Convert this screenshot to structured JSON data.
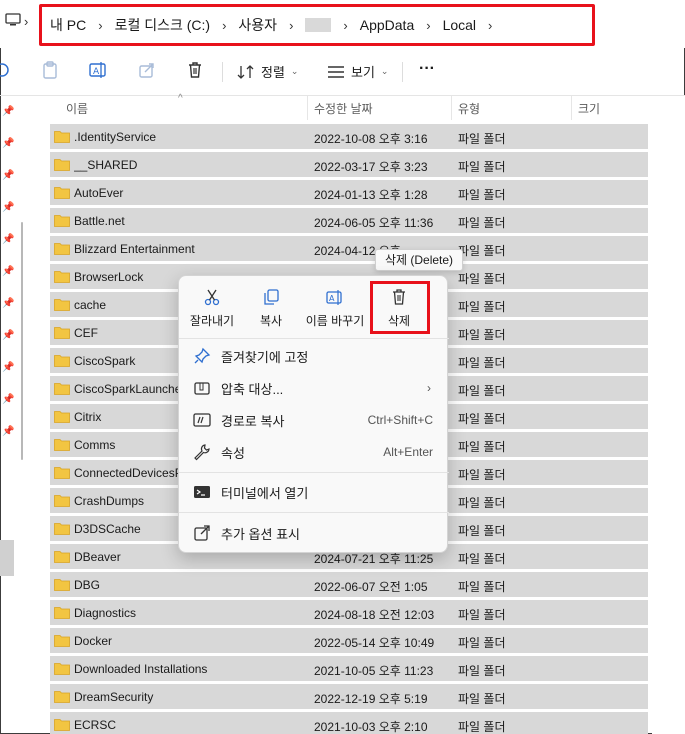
{
  "breadcrumbs": [
    "내 PC",
    "로컬 디스크 (C:)",
    "사용자",
    "",
    "AppData",
    "Local"
  ],
  "toolbar": {
    "sort_label": "정렬",
    "view_label": "보기",
    "more_label": "···"
  },
  "columns": {
    "name": "이름",
    "modified": "수정한 날짜",
    "type": "유형",
    "size": "크기"
  },
  "rows": [
    {
      "name": ".IdentityService",
      "date": "2022-10-08 오후 3:16",
      "type": "파일 폴더"
    },
    {
      "name": "__SHARED",
      "date": "2022-03-17 오후 3:23",
      "type": "파일 폴더"
    },
    {
      "name": "AutoEver",
      "date": "2024-01-13 오후 1:28",
      "type": "파일 폴더"
    },
    {
      "name": "Battle.net",
      "date": "2024-06-05 오후 11:36",
      "type": "파일 폴더"
    },
    {
      "name": "Blizzard Entertainment",
      "date": "2024-04-12 오후 ",
      "type": "파일 폴더"
    },
    {
      "name": "BrowserLock",
      "date": "",
      "type": "파일 폴더"
    },
    {
      "name": "cache",
      "date": "",
      "type": "파일 폴더"
    },
    {
      "name": "CEF",
      "date": "",
      "type": "파일 폴더"
    },
    {
      "name": "CiscoSpark",
      "date": "",
      "type": "파일 폴더"
    },
    {
      "name": "CiscoSparkLauncher",
      "date": "",
      "type": "파일 폴더"
    },
    {
      "name": "Citrix",
      "date": "",
      "type": "파일 폴더"
    },
    {
      "name": "Comms",
      "date": "",
      "type": "파일 폴더"
    },
    {
      "name": "ConnectedDevicesPlatform",
      "date": "",
      "type": "파일 폴더"
    },
    {
      "name": "CrashDumps",
      "date": "",
      "type": "파일 폴더"
    },
    {
      "name": "D3DSCache",
      "date": "",
      "type": "파일 폴더"
    },
    {
      "name": "DBeaver",
      "date": "2024-07-21 오후 11:25",
      "type": "파일 폴더"
    },
    {
      "name": "DBG",
      "date": "2022-06-07 오전 1:05",
      "type": "파일 폴더"
    },
    {
      "name": "Diagnostics",
      "date": "2024-08-18 오전 12:03",
      "type": "파일 폴더"
    },
    {
      "name": "Docker",
      "date": "2022-05-14 오후 10:49",
      "type": "파일 폴더"
    },
    {
      "name": "Downloaded Installations",
      "date": "2021-10-05 오후 11:23",
      "type": "파일 폴더"
    },
    {
      "name": "DreamSecurity",
      "date": "2022-12-19 오후 5:19",
      "type": "파일 폴더"
    },
    {
      "name": "ECRSC",
      "date": "2021-10-03 오후 2:10",
      "type": "파일 폴더"
    }
  ],
  "context_menu": {
    "quick_actions": {
      "cut": "잘라내기",
      "copy": "복사",
      "rename": "이름 바꾸기",
      "delete": "삭제"
    },
    "items": {
      "pin": "즐겨찾기에 고정",
      "compress": "압축 대상...",
      "copy_path": "경로로 복사",
      "copy_path_shortcut": "Ctrl+Shift+C",
      "properties": "속성",
      "properties_shortcut": "Alt+Enter",
      "terminal": "터미널에서 열기",
      "more_options": "추가 옵션 표시"
    }
  },
  "tooltip": "삭제 (Delete)",
  "colors": {
    "highlight_red": "#e8111b",
    "folder_yellow": "#f2c542",
    "row_selected": "#d8d8d8",
    "accent_blue": "#2f6fd0"
  }
}
